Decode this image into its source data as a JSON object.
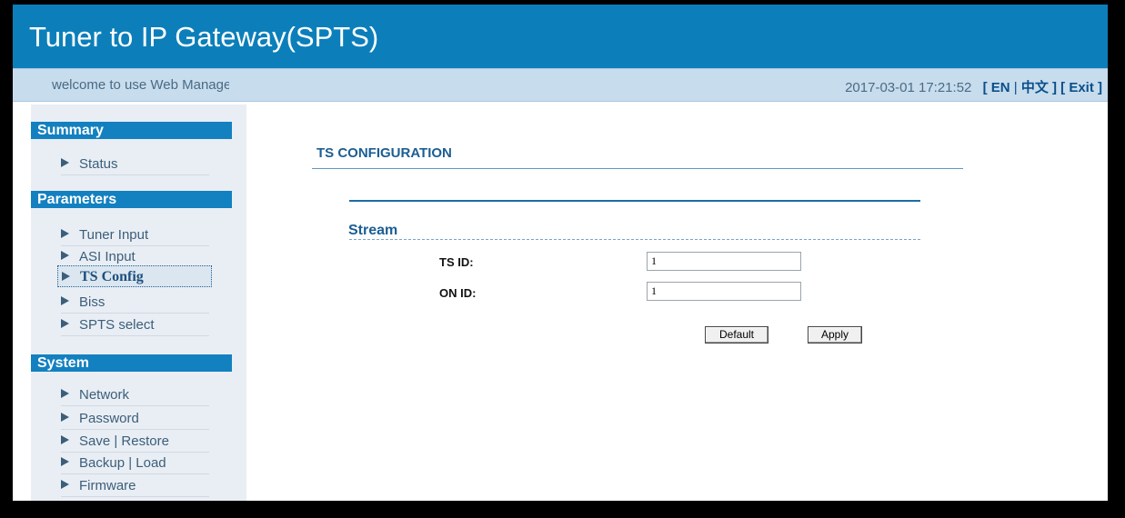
{
  "app": {
    "title": "Tuner to IP Gateway(SPTS)",
    "welcome": "welcome to use Web Management System",
    "datetime": "2017-03-01 17:21:52",
    "lang_en": "[ EN",
    "lang_sep": "|",
    "lang_zh": "中文 ]",
    "exit": "[ Exit ]"
  },
  "sidebar": {
    "summary": {
      "heading": "Summary",
      "items": [
        "Status"
      ]
    },
    "parameters": {
      "heading": "Parameters",
      "items": [
        "Tuner Input",
        "ASI Input",
        "TS Config",
        "Biss",
        "SPTS select"
      ],
      "active_index": 2
    },
    "system": {
      "heading": "System",
      "items": [
        "Network",
        "Password",
        "Save | Restore",
        "Backup | Load",
        "Firmware"
      ]
    }
  },
  "main": {
    "section_title": "TS CONFIGURATION",
    "group_label": "Stream",
    "fields": [
      {
        "label": "TS ID:",
        "value": "1"
      },
      {
        "label": "ON ID:",
        "value": "1"
      }
    ],
    "buttons": {
      "default": "Default",
      "apply": "Apply"
    }
  },
  "colors": {
    "header_bg": "#0c7fba",
    "section_head_bg": "#1380c0",
    "subbar_bg": "#c7dced"
  }
}
